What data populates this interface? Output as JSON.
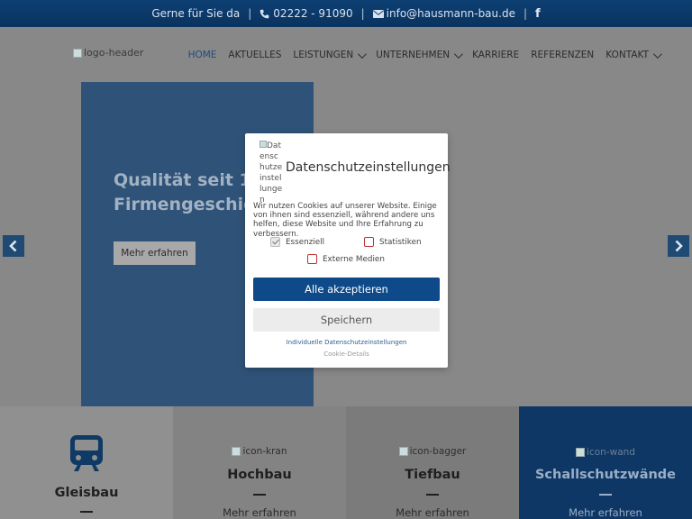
{
  "topbar": {
    "tagline": "Gerne für Sie da",
    "sep": "|",
    "phone": "02222 - 91090",
    "email": "info@hausmann-bau.de",
    "facebook_glyph": "f",
    "icons": [
      "phone-icon",
      "mail-icon",
      "facebook-icon"
    ]
  },
  "header": {
    "logo_alt": "logo-header"
  },
  "nav": {
    "items": [
      {
        "label": "HOME",
        "active": true,
        "has_dropdown": false
      },
      {
        "label": "AKTUELLES",
        "has_dropdown": false
      },
      {
        "label": "LEISTUNGEN",
        "has_dropdown": true
      },
      {
        "label": "UNTERNEHMEN",
        "has_dropdown": true
      },
      {
        "label": "KARRIERE",
        "has_dropdown": false
      },
      {
        "label": "REFERENZEN",
        "has_dropdown": false
      },
      {
        "label": "KONTAKT",
        "has_dropdown": true
      }
    ]
  },
  "hero": {
    "title_line1": "Qualität seit 194",
    "title_line2": "Firmengeschich",
    "button_label": "Mehr erfahren"
  },
  "tiles": [
    {
      "name": "Gleisbau",
      "icon": "train-icon",
      "icon_alt": "",
      "link": ""
    },
    {
      "name": "Hochbau",
      "icon_alt": "icon-kran",
      "link": "Mehr erfahren"
    },
    {
      "name": "Tiefbau",
      "icon_alt": "icon-bagger",
      "link": "Mehr erfahren"
    },
    {
      "name": "Schallschutzwände",
      "icon_alt": "icon-wand",
      "link": "Mehr erfahren"
    }
  ],
  "cookie": {
    "logo_alt": "Datenschutzeinstellungen",
    "title": "Datenschutzeinstellungen",
    "text": "Wir nutzen Cookies auf unserer Website. Einige von ihnen sind essenziell, während andere uns helfen, diese Website und Ihre Erfahrung zu verbessern.",
    "options": {
      "essenziell": {
        "label": "Essenziell",
        "checked": true
      },
      "statistiken": {
        "label": "Statistiken",
        "checked": false
      },
      "externe": {
        "label": "Externe Medien",
        "checked": false
      }
    },
    "accept_all": "Alle akzeptieren",
    "save": "Speichern",
    "individual": "Individuelle Datenschutzeinstellungen",
    "details": "Cookie-Details"
  },
  "colors": {
    "topbar": "#0d3f73",
    "hero_panel": "#2f5378",
    "accept_button": "#0e4a8a",
    "tile_dark": "#0e3766"
  }
}
